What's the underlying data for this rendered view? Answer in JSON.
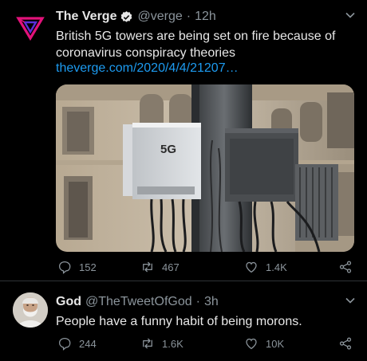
{
  "tweets": [
    {
      "author": {
        "name": "The Verge",
        "handle": "@verge",
        "verified": true
      },
      "time": "12h",
      "text": "British 5G towers are being set on fire because of coronavirus conspiracy theories",
      "link": "theverge.com/2020/4/4/21207…",
      "media": {
        "label": "5G"
      },
      "stats": {
        "replies": "152",
        "retweets": "467",
        "likes": "1.4K"
      }
    },
    {
      "author": {
        "name": "God",
        "handle": "@TheTweetOfGod"
      },
      "time": "3h",
      "text": "People have a funny habit of being morons.",
      "stats": {
        "replies": "244",
        "retweets": "1.6K",
        "likes": "10K"
      }
    }
  ],
  "colors": {
    "background": "#000000",
    "link": "#1d9bf0",
    "muted": "#8b949b",
    "text": "#e7e7e7",
    "verge_logo": "#e2127a"
  },
  "icons": {
    "reply": "reply-icon",
    "retweet": "retweet-icon",
    "like": "heart-icon",
    "share": "share-icon",
    "menu": "chevron-down-icon",
    "verified": "verified-badge-icon"
  }
}
